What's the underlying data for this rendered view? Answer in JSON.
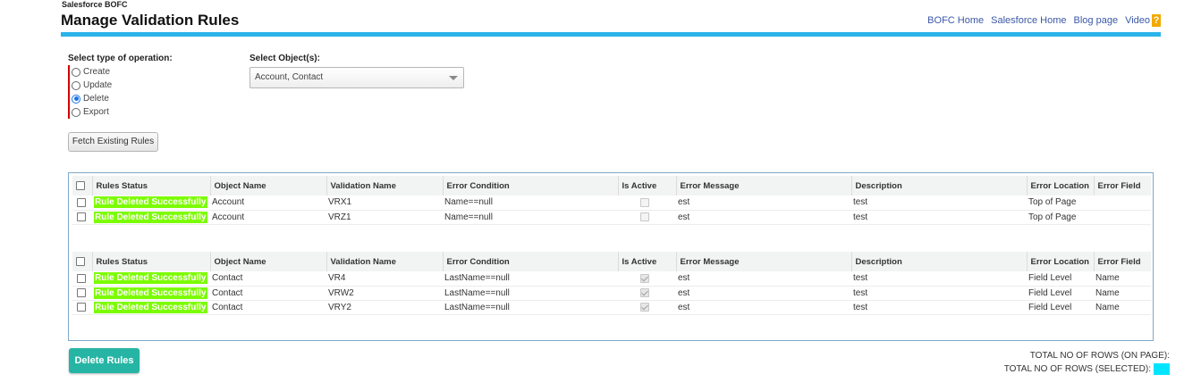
{
  "app": {
    "name": "Salesforce BOFC",
    "title": "Manage Validation Rules"
  },
  "top_links": {
    "bofc_home": "BOFC Home",
    "salesforce_home": "Salesforce Home",
    "blog_page": "Blog page",
    "video": "Video",
    "help": "?"
  },
  "operation": {
    "label": "Select type of operation:",
    "options": [
      "Create",
      "Update",
      "Delete",
      "Export"
    ],
    "selected": "Delete"
  },
  "objects": {
    "label": "Select Object(s):",
    "value": "Account, Contact"
  },
  "fetch_button": "Fetch Existing Rules",
  "table_headers": [
    "Rules Status",
    "Object Name",
    "Validation Name",
    "Error Condition",
    "Is Active",
    "Error Message",
    "Description",
    "Error Location",
    "Error Field"
  ],
  "groups": [
    {
      "rows": [
        {
          "status": "Rule Deleted Successfully",
          "object": "Account",
          "validation": "VRX1",
          "condition": "Name==null",
          "active": false,
          "message": "est",
          "description": "test",
          "location": "Top of Page",
          "field": ""
        },
        {
          "status": "Rule Deleted Successfully",
          "object": "Account",
          "validation": "VRZ1",
          "condition": "Name==null",
          "active": false,
          "message": "est",
          "description": "test",
          "location": "Top of Page",
          "field": ""
        }
      ]
    },
    {
      "rows": [
        {
          "status": "Rule Deleted Successfully",
          "object": "Contact",
          "validation": "VR4",
          "condition": "LastName==null",
          "active": true,
          "message": "est",
          "description": "test",
          "location": "Field Level",
          "field": "Name"
        },
        {
          "status": "Rule Deleted Successfully",
          "object": "Contact",
          "validation": "VRW2",
          "condition": "LastName==null",
          "active": true,
          "message": "est",
          "description": "test",
          "location": "Field Level",
          "field": "Name"
        },
        {
          "status": "Rule Deleted Successfully",
          "object": "Contact",
          "validation": "VRY2",
          "condition": "LastName==null",
          "active": true,
          "message": "est",
          "description": "test",
          "location": "Field Level",
          "field": "Name"
        }
      ]
    }
  ],
  "delete_button": "Delete Rules",
  "totals": {
    "on_page_label": "TOTAL NO OF ROWS (ON PAGE):",
    "selected_label": "TOTAL NO OF ROWS (SELECTED):"
  },
  "colors": {
    "accent_bar": "#2bb3ea",
    "status_green": "#7cfc00",
    "delete_button": "#26b5a4",
    "selected_badge": "#00e5ff",
    "required_marker": "#d10000"
  }
}
